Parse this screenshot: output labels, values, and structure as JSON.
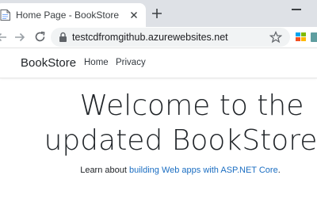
{
  "browser": {
    "tab": {
      "title": "Home Page - BookStore"
    },
    "address_bar": {
      "url": "testcdfromgithub.azurewebsites.net"
    }
  },
  "site": {
    "brand": "BookStore",
    "nav": [
      "Home",
      "Privacy"
    ]
  },
  "main": {
    "heading_line1": "Welcome to the",
    "heading_line2": "updated BookStore",
    "learn_prefix": "Learn about",
    "learn_link": "building Web apps with ASP.NET Core",
    "learn_suffix": "."
  },
  "colors": {
    "tabstrip": "#dee1e6",
    "omnibox": "#f1f3f4",
    "link": "#1b6ec2",
    "text": "#212529"
  }
}
